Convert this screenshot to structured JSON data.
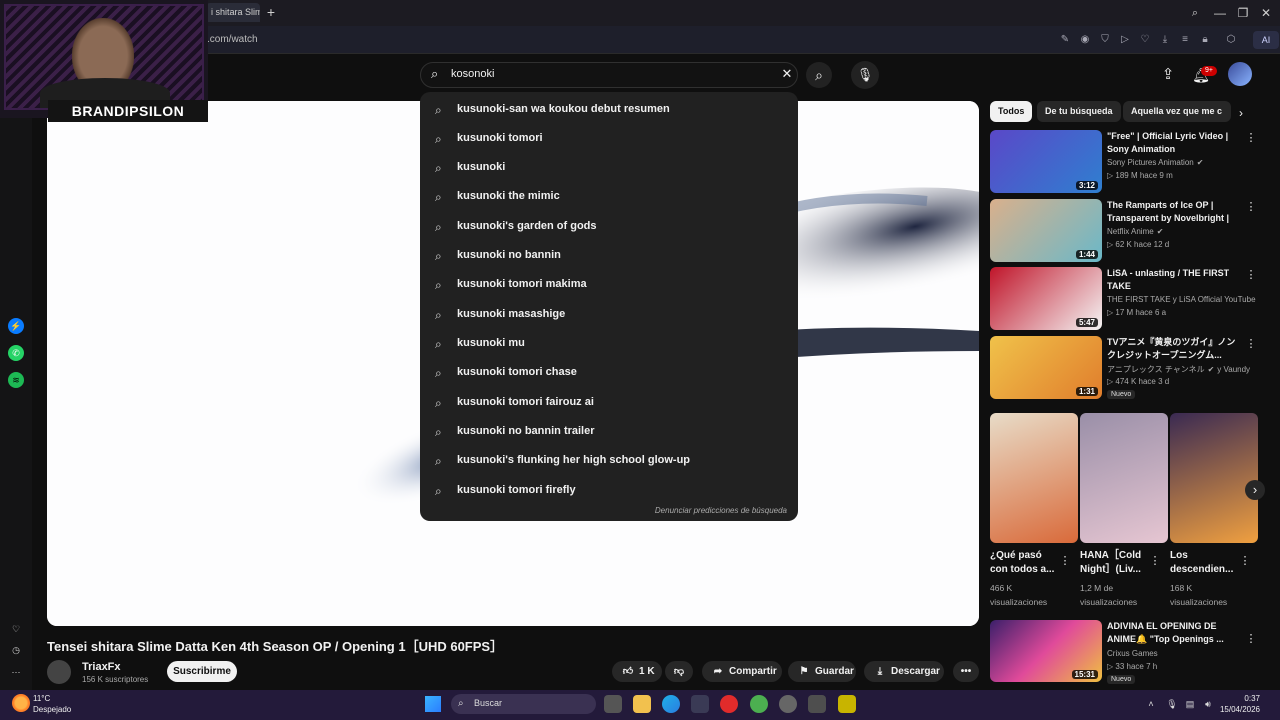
{
  "browser": {
    "tab_title": "i shitara Slim",
    "new_tab": "+",
    "url": ".com/watch",
    "ai_label": "AI",
    "window_controls": [
      "—",
      "❐",
      "✕"
    ]
  },
  "overlay": {
    "streamer_name": "BRANDIPSILON"
  },
  "header": {
    "search_value": "kosonoki",
    "notification_count": "9+"
  },
  "suggestions": {
    "items": [
      "kusunoki-san wa koukou debut resumen",
      "kusunoki tomori",
      "kusunoki",
      "kusunoki the mimic",
      "kusunoki's garden of gods",
      "kusunoki no bannin",
      "kusunoki tomori makima",
      "kusunoki masashige",
      "kusunoki mu",
      "kusunoki tomori chase",
      "kusunoki tomori fairouz ai",
      "kusunoki no bannin trailer",
      "kusunoki's flunking her high school glow-up",
      "kusunoki tomori firefly"
    ],
    "report_link": "Denunciar predicciones de búsqueda"
  },
  "video": {
    "title": "Tensei shitara Slime Datta Ken 4th Season OP / Opening 1［UHD 60FPS］",
    "channel_name": "TriaxFx",
    "channel_subs": "156 K suscriptores",
    "subscribe_label": "Suscribirme",
    "like_count": "1 K",
    "share_label": "Compartir",
    "save_label": "Guardar",
    "download_label": "Descargar",
    "more_label": "•••"
  },
  "filters": {
    "chips": [
      "Todos",
      "De tu búsqueda",
      "Aquella vez que me c"
    ]
  },
  "recommendations": [
    {
      "title": "\"Free\" | Official Lyric Video | Sony Animation",
      "channel": "Sony Pictures Animation",
      "meta": "189 M  hace 9 m",
      "duration": "3:12",
      "verified": true,
      "badge": "",
      "color_a": "#5a48c8",
      "color_b": "#2f7fd0"
    },
    {
      "title": "The Ramparts of Ice OP | Transparent by Novelbright | ...",
      "channel": "Netflix Anime",
      "meta": "62 K  hace 12 d",
      "duration": "1:44",
      "verified": true,
      "badge": "",
      "color_a": "#d9b08c",
      "color_b": "#6ab8c8"
    },
    {
      "title": "LiSA - unlasting / THE FIRST TAKE",
      "channel": "THE FIRST TAKE y LiSA Official YouTube",
      "meta": "17 M  hace 6 a",
      "duration": "5:47",
      "verified": false,
      "badge": "",
      "color_a": "#c0152a",
      "color_b": "#f5f5f5"
    },
    {
      "title": "TVアニメ『黄泉のツガイ』ノンクレジットオープニングム...",
      "channel": "アニプレックス チャンネル",
      "meta": "474 K  hace 3 d",
      "duration": "1:31",
      "verified": true,
      "badge": "Nuevo",
      "color_a": "#f0c24a",
      "color_b": "#e07d2c"
    }
  ],
  "recommendation_extra": {
    "channel_suffix": "y Vaundy"
  },
  "shorts": [
    {
      "title": "¿Qué pasó con todos a...",
      "views": "466 K visualizaciones",
      "color_a": "#e8dcc8",
      "color_b": "#d96a3a"
    },
    {
      "title": "HANA［Cold Night］(Liv...",
      "views": "1,2 M de visualizaciones",
      "color_a": "#9a8fa8",
      "color_b": "#e6c6d2"
    },
    {
      "title": "Los descendien...",
      "views": "168 K visualizaciones",
      "color_a": "#3a2a52",
      "color_b": "#f0a040"
    }
  ],
  "recommendation_bottom": {
    "title": "ADIVINA EL OPENING DE ANIME🔔 \"Top Openings ...",
    "channel": "Crixus Games",
    "meta": "33  hace 7 h",
    "duration": "15:31",
    "badge": "Nuevo"
  },
  "taskbar": {
    "temperature": "11°C",
    "weather": "Despejado",
    "search_label": "Buscar",
    "time": "0:37",
    "date": "15/04/2026"
  }
}
